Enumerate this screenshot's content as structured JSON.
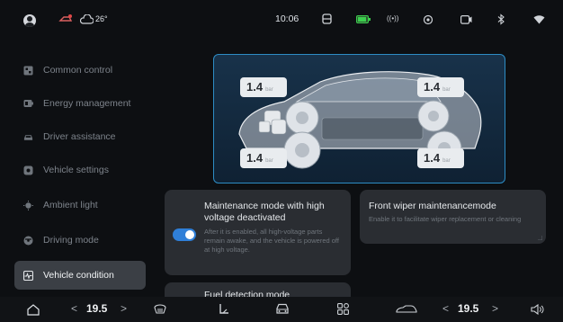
{
  "status": {
    "weather": "26°",
    "time": "10:06"
  },
  "sidebar": {
    "items": [
      {
        "label": "Common control",
        "icon": "grid-icon"
      },
      {
        "label": "Energy management",
        "icon": "battery-icon"
      },
      {
        "label": "Driver assistance",
        "icon": "car-icon"
      },
      {
        "label": "Vehicle settings",
        "icon": "gear-icon"
      },
      {
        "label": "Ambient light",
        "icon": "bulb-icon"
      },
      {
        "label": "Driving mode",
        "icon": "steering-icon"
      },
      {
        "label": "Vehicle condition",
        "icon": "pulse-icon",
        "active": true
      }
    ]
  },
  "tire_pressure": {
    "front_left": {
      "value": "1.4",
      "unit": "bar"
    },
    "rear_left": {
      "value": "1.4",
      "unit": "bar"
    },
    "front_right": {
      "value": "1.4",
      "unit": "bar"
    },
    "rear_right": {
      "value": "1.4",
      "unit": "bar"
    }
  },
  "cards": {
    "maintenance": {
      "title": "Maintenance mode with high voltage deactivated",
      "desc": "After it is enabled, all high-voltage parts remain awake, and the vehicle is powered off at high voltage.",
      "enabled": true
    },
    "wiper": {
      "title": "Front wiper maintenancemode",
      "desc": "Enable it to facilitate wiper replacement or cleaning"
    },
    "fuel": {
      "title": "Fuel detection mode"
    }
  },
  "bottom": {
    "driver_temp": "19.5",
    "passenger_temp": "19.5"
  },
  "colors": {
    "accent": "#2f7fd8",
    "panel_border": "#2d8cc4",
    "active_item": "#3b3f45",
    "battery": "#3ccf4e",
    "notice": "#e04848"
  }
}
